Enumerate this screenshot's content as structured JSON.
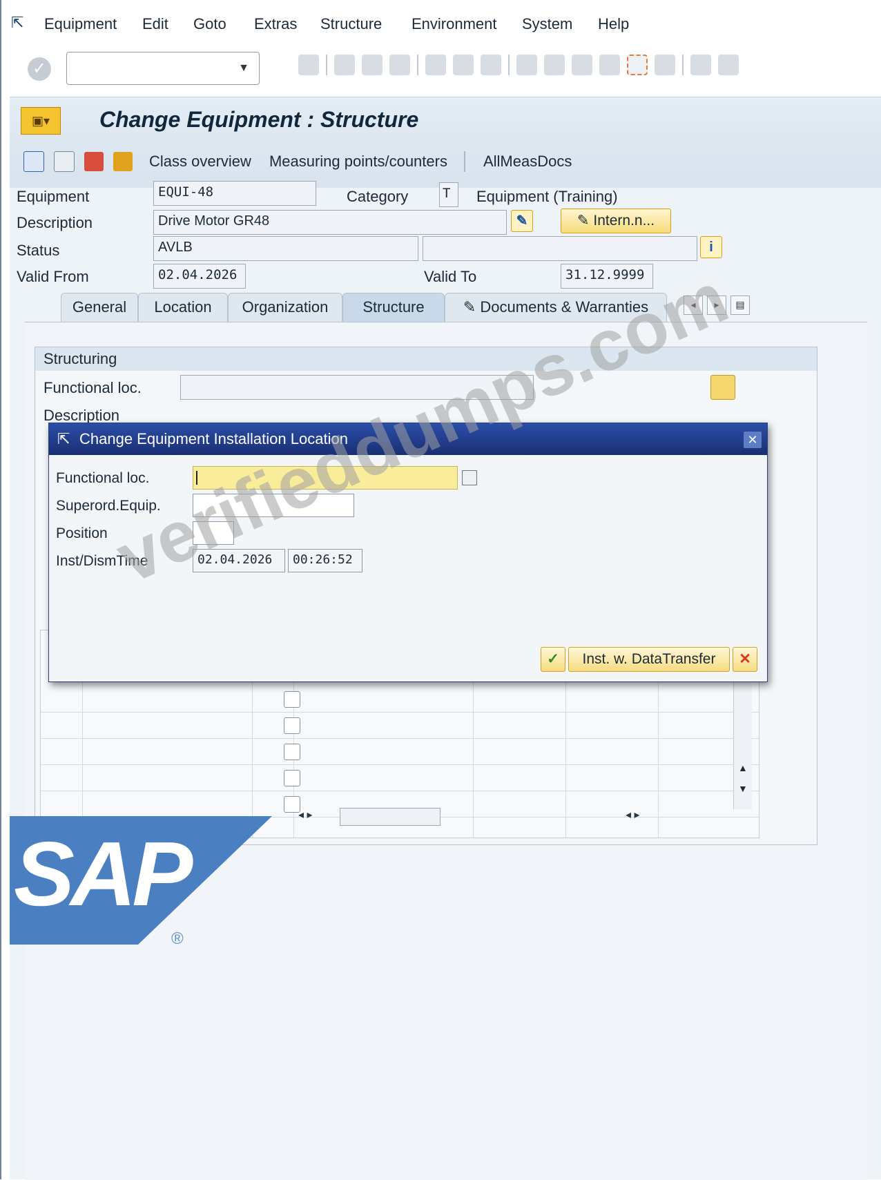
{
  "menu": {
    "items": [
      "Equipment",
      "Edit",
      "Goto",
      "Extras",
      "Structure",
      "Environment",
      "System",
      "Help"
    ]
  },
  "title": "Change Equipment : Structure",
  "app_toolbar": {
    "class_overview": "Class overview",
    "measuring_points": "Measuring points/counters",
    "all_meas_docs": "AllMeasDocs"
  },
  "header": {
    "equipment_label": "Equipment",
    "equipment_value": "EQUI-48",
    "category_label": "Category",
    "category_value": "T",
    "category_text": "Equipment (Training)",
    "description_label": "Description",
    "description_value": "Drive Motor GR48",
    "intern_button": "Intern.n...",
    "status_label": "Status",
    "status_value": "AVLB",
    "valid_from_label": "Valid From",
    "valid_from_value": "02.04.2026",
    "valid_to_label": "Valid To",
    "valid_to_value": "31.12.9999"
  },
  "tabs": [
    "General",
    "Location",
    "Organization",
    "Structure",
    "Documents & Warranties"
  ],
  "active_tab": "Structure",
  "structuring": {
    "title": "Structuring",
    "functional_loc_label": "Functional loc.",
    "description_label": "Description"
  },
  "dialog": {
    "title": "Change Equipment Installation Location",
    "functional_loc_label": "Functional loc.",
    "superord_label": "Superord.Equip.",
    "position_label": "Position",
    "inst_time_label": "Inst/DismTime",
    "inst_date": "02.04.2026",
    "inst_time": "00:26:52",
    "transfer_button": "Inst. w. DataTransfer"
  },
  "logo": {
    "text": "SAP",
    "registered": "®"
  },
  "watermark": "verifieddumps.com",
  "colors": {
    "dialog_title": "#1f3c8f",
    "required_field": "#f9ec9b",
    "button_yellow": "#f6dc80"
  }
}
